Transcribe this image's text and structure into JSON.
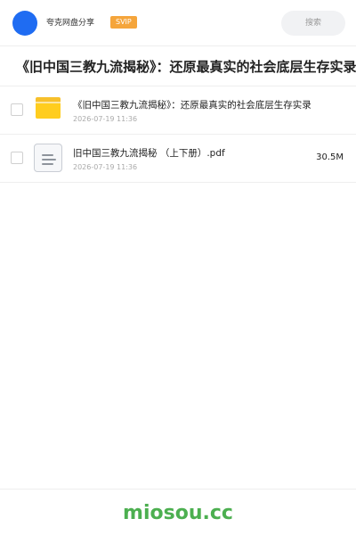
{
  "header": {
    "username": "夸克网盘分享",
    "badge": "SVIP",
    "search_label": "搜索"
  },
  "share": {
    "title": "《旧中国三教九流揭秘》：还原最真实的社会底层生存实录"
  },
  "files": [
    {
      "name": "《旧中国三教九流揭秘》：还原最真实的社会底层生存实录",
      "date": "2026-07-19 11:36",
      "size": "",
      "icon": "folder-icon"
    },
    {
      "name": "旧中国三教九流揭秘 （上下册）.pdf",
      "date": "2026-07-19 11:36",
      "size": "30.5M",
      "icon": "document-icon"
    }
  ],
  "footer": {
    "watermark": "miosou.cc"
  },
  "colors": {
    "avatar": "#1f6cf2",
    "badge": "#f5a53b",
    "folder": "#ffcd1e",
    "watermark": "#4caf50"
  }
}
